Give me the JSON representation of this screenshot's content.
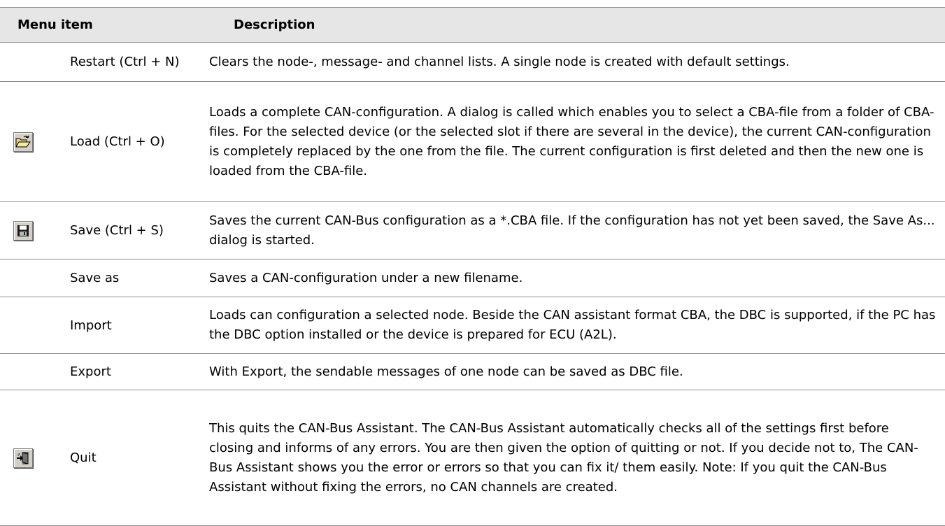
{
  "table": {
    "header": {
      "menu_item": "Menu item",
      "description": "Description"
    },
    "rows": [
      {
        "icon": "",
        "name": "Restart (Ctrl + N)",
        "description": "Clears the node-, message- and channel lists. A single node is created with default settings."
      },
      {
        "icon": "open-folder-icon",
        "name": "Load (Ctrl + O)",
        "description": "Loads a complete CAN-configuration. A dialog is called which enables you to select a CBA-file from a folder of CBA-files. For the selected device (or the selected slot if there are several in the device), the current CAN-configuration is completely replaced by the one from the file. The current configuration is first deleted and then the new one is loaded from the CBA-file."
      },
      {
        "icon": "floppy-disk-icon",
        "name": "Save (Ctrl + S)",
        "description": "Saves the current CAN-Bus configuration as a *.CBA file. If the configuration has not yet been saved, the Save As... dialog is started."
      },
      {
        "icon": "",
        "name": "Save as",
        "description": "Saves a CAN-configuration under a new filename."
      },
      {
        "icon": "",
        "name": "Import",
        "description": "Loads can configuration a selected node. Beside the CAN assistant format CBA, the DBC is supported, if the PC has the DBC option installed or the device is prepared for ECU (A2L)."
      },
      {
        "icon": "",
        "name": "Export",
        "description": "With Export, the sendable messages of one node can be saved as DBC file."
      },
      {
        "icon": "quit-door-icon",
        "name": "Quit",
        "description": "This quits the CAN-Bus Assistant. The CAN-Bus Assistant automatically checks all of the settings first before closing and informs of any errors. You are then given the option of quitting or not. If you decide not to, The CAN-Bus Assistant shows you the error or errors so that you can fix it/ them easily. Note: If you quit the CAN-Bus Assistant without fixing the errors, no CAN channels are created."
      }
    ]
  }
}
